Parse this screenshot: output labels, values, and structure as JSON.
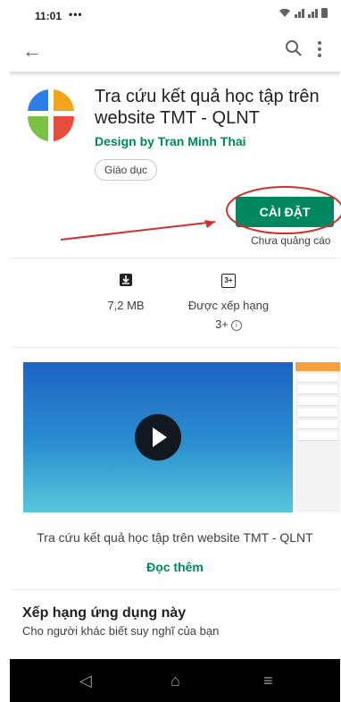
{
  "status_bar": {
    "time": "11:01",
    "dots": "•••"
  },
  "app": {
    "title": "Tra cứu kết quả học tập trên website TMT - QLNT",
    "developer": "Design by Tran Minh Thai",
    "category": "Giáo dục",
    "logo_colors": [
      "#2b7de9",
      "#f0a51d",
      "#7cc242",
      "#e84c3d"
    ]
  },
  "install": {
    "label": "CÀI ĐẶT",
    "ads_note": "Chưa quảng cáo"
  },
  "stats": {
    "size": "7,2 MB",
    "rating_label": "Được xếp hạng",
    "rating_value": "3+",
    "rating_badge": "3+",
    "info_glyph": "i"
  },
  "description": {
    "caption": "Tra cứu kết quả học tập trên website TMT - QLNT",
    "read_more": "Đọc thêm"
  },
  "rate_section": {
    "title": "Xếp hạng ứng dụng này",
    "subtitle": "Cho người khác biết suy nghĩ của bạn"
  },
  "nav": {
    "back": "◁",
    "home": "⌂",
    "recents": "≡"
  },
  "colors": {
    "accent": "#01875f",
    "annotation": "#d0302f"
  }
}
